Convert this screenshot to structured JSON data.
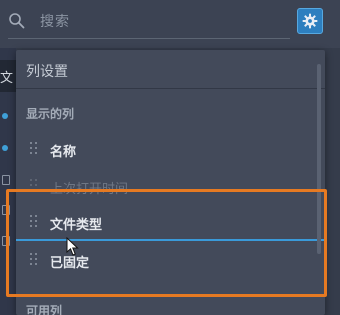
{
  "search": {
    "placeholder": "搜索"
  },
  "background_table": {
    "header_text": "文"
  },
  "panel": {
    "title": "列设置",
    "visible_section_label": "显示的列",
    "visible_columns": [
      {
        "label": "名称",
        "state": "normal"
      },
      {
        "label": "上次打开时间",
        "state": "dragging-source"
      },
      {
        "label": "文件类型",
        "state": "normal"
      },
      {
        "label": "已固定",
        "state": "normal"
      }
    ],
    "available_section_label": "可用列"
  },
  "colors": {
    "accent": "#2d7fbf",
    "drop_indicator": "#3a9ad9",
    "highlight": "#e67a22"
  },
  "icons": [
    "search-icon",
    "gear-icon",
    "drag-handle-icon",
    "mouse-cursor-icon"
  ]
}
